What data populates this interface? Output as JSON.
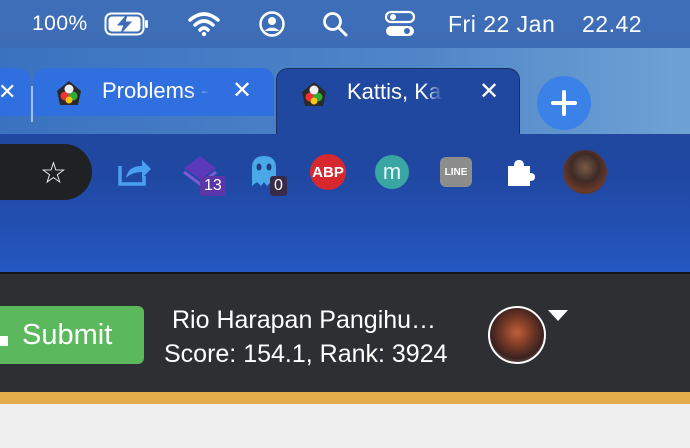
{
  "menubar": {
    "battery_percent": "100%",
    "date": "Fri 22 Jan",
    "time": "22.42",
    "icons": [
      "battery-charging-icon",
      "wifi-icon",
      "user-circle-icon",
      "search-icon",
      "control-center-icon"
    ]
  },
  "tabs": [
    {
      "title": "Problems -",
      "active": false
    },
    {
      "title": "Kattis, Kattis",
      "active": true
    }
  ],
  "toolbar": {
    "extensions": [
      {
        "name": "share-icon"
      },
      {
        "name": "stackedit-icon",
        "badge": "13"
      },
      {
        "name": "ghostery-icon",
        "badge": "0"
      },
      {
        "name": "adblock-plus-icon",
        "label": "ABP"
      },
      {
        "name": "mendeley-icon",
        "label": "m"
      },
      {
        "name": "line-icon",
        "label": "LINE"
      },
      {
        "name": "puzzle-extensions-icon"
      }
    ]
  },
  "page": {
    "submit_label": "Submit",
    "user_name": "Rio Harapan Pangihu…",
    "score_line": "Score: 154.1, Rank: 3924"
  },
  "colors": {
    "submit_green": "#5cb85c",
    "header_dark": "#2d2f33",
    "gold_bar": "#e2ad4a",
    "toolbar_blue": "#2148a0"
  }
}
